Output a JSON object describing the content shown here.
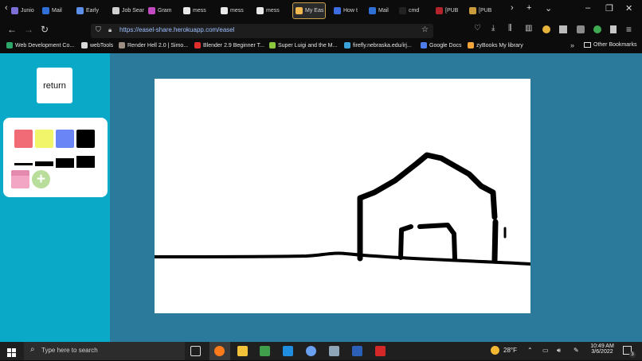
{
  "browser": {
    "tabs": [
      {
        "label": "Junio",
        "color": "#7b6fd6"
      },
      {
        "label": "Mail",
        "color": "#2f6fd6"
      },
      {
        "label": "Early",
        "color": "#5b8fe8"
      },
      {
        "label": "Job Search",
        "color": "#cfcfcf"
      },
      {
        "label": "Gram",
        "color": "#c14ac0"
      },
      {
        "label": "mess",
        "color": "#e8e8e8"
      },
      {
        "label": "mess",
        "color": "#e8e8e8"
      },
      {
        "label": "mess",
        "color": "#e8e8e8"
      },
      {
        "label": "My Eas",
        "color": "#f0b84e",
        "active": true
      },
      {
        "label": "How t",
        "color": "#3d6ce0"
      },
      {
        "label": "Mail",
        "color": "#2f6fd6"
      },
      {
        "label": "cmd",
        "color": "#222"
      },
      {
        "label": "[PUB",
        "color": "#b3232b"
      },
      {
        "label": "[PUB",
        "color": "#c99b3a"
      }
    ],
    "url": "https://easel-share.herokuapp.com/easel",
    "bookmarks": [
      {
        "label": "Web Development Co...",
        "color": "#2da86b"
      },
      {
        "label": "webTools",
        "color": "#d8d8d8"
      },
      {
        "label": "Render Hell 2.0 | Simo...",
        "color": "#9a8f80"
      },
      {
        "label": "Blender 2.9 Beginner T...",
        "color": "#e22d2d"
      },
      {
        "label": "Super Luigi and the M...",
        "color": "#8dc63f"
      },
      {
        "label": "firefly.nebraska.edu/irj...",
        "color": "#39a3d8"
      },
      {
        "label": "Google Docs",
        "color": "#4f7bea"
      },
      {
        "label": "zyBooks My library",
        "color": "#f2a33a"
      }
    ],
    "other_bookmarks": "Other Bookmarks"
  },
  "easel": {
    "return_label": "return",
    "colors": [
      "#f06b75",
      "#f0f56a",
      "#6a86f6",
      "#000000"
    ],
    "brush_sizes": [
      "extra small",
      "small",
      "medium",
      "large"
    ]
  },
  "taskbar": {
    "search_placeholder": "Type here to search",
    "temperature": "28°F",
    "time": "10:49 AM",
    "date": "3/6/2022",
    "notification_count": "3"
  }
}
